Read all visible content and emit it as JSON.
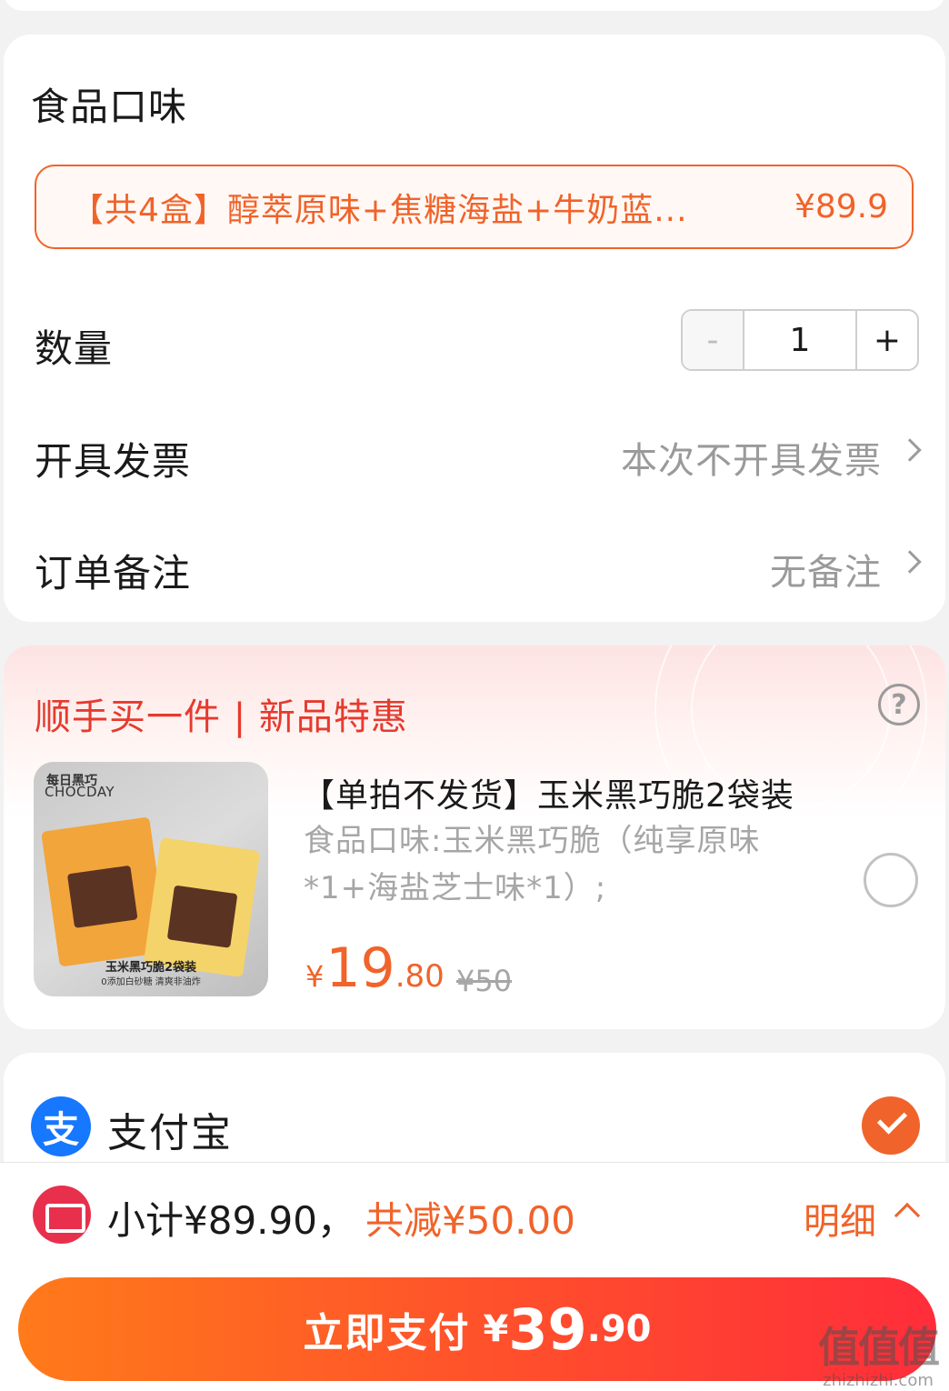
{
  "options": {
    "flavor_title": "食品口味",
    "flavor_selected": "【共4盒】醇萃原味+焦糖海盐+牛奶蓝...",
    "flavor_price": "¥89.9",
    "quantity_label": "数量",
    "quantity": {
      "minus": "-",
      "value": "1",
      "plus": "+"
    },
    "invoice_label": "开具发票",
    "invoice_value": "本次不开具发票",
    "remark_label": "订单备注",
    "remark_value": "无备注"
  },
  "upsell": {
    "title": "顺手买一件 | 新品特惠",
    "help_icon": "?",
    "product": {
      "image_brand_cn": "每日黑巧",
      "image_brand_en": "CHOCDAY",
      "image_caption": "玉米黑巧脆2袋装",
      "image_subcaption": "0添加白砂糖 清爽非油炸",
      "title": "【单拍不发货】玉米黑巧脆2袋装",
      "spec": "食品口味:玉米黑巧脆（纯享原味*1+海盐芝士味*1）;",
      "price_symbol": "¥",
      "price_int": "19",
      "price_dec": ".80",
      "original_price": "¥50"
    }
  },
  "payment": {
    "method_label": "支付宝",
    "method_icon": "支"
  },
  "bottom_bar": {
    "subtotal": "小计¥89.90，",
    "discount": "共减¥50.00",
    "detail": "明细",
    "pay_label": "立即支付",
    "pay_symbol": "¥",
    "pay_int": "39",
    "pay_dec": ".90"
  },
  "watermark": {
    "line1": "值值值",
    "line2": "zhizhizhi.com"
  },
  "colors": {
    "accent": "#f0632a",
    "upsell_red": "#e63a2e",
    "alipay_blue": "#1677ff"
  }
}
